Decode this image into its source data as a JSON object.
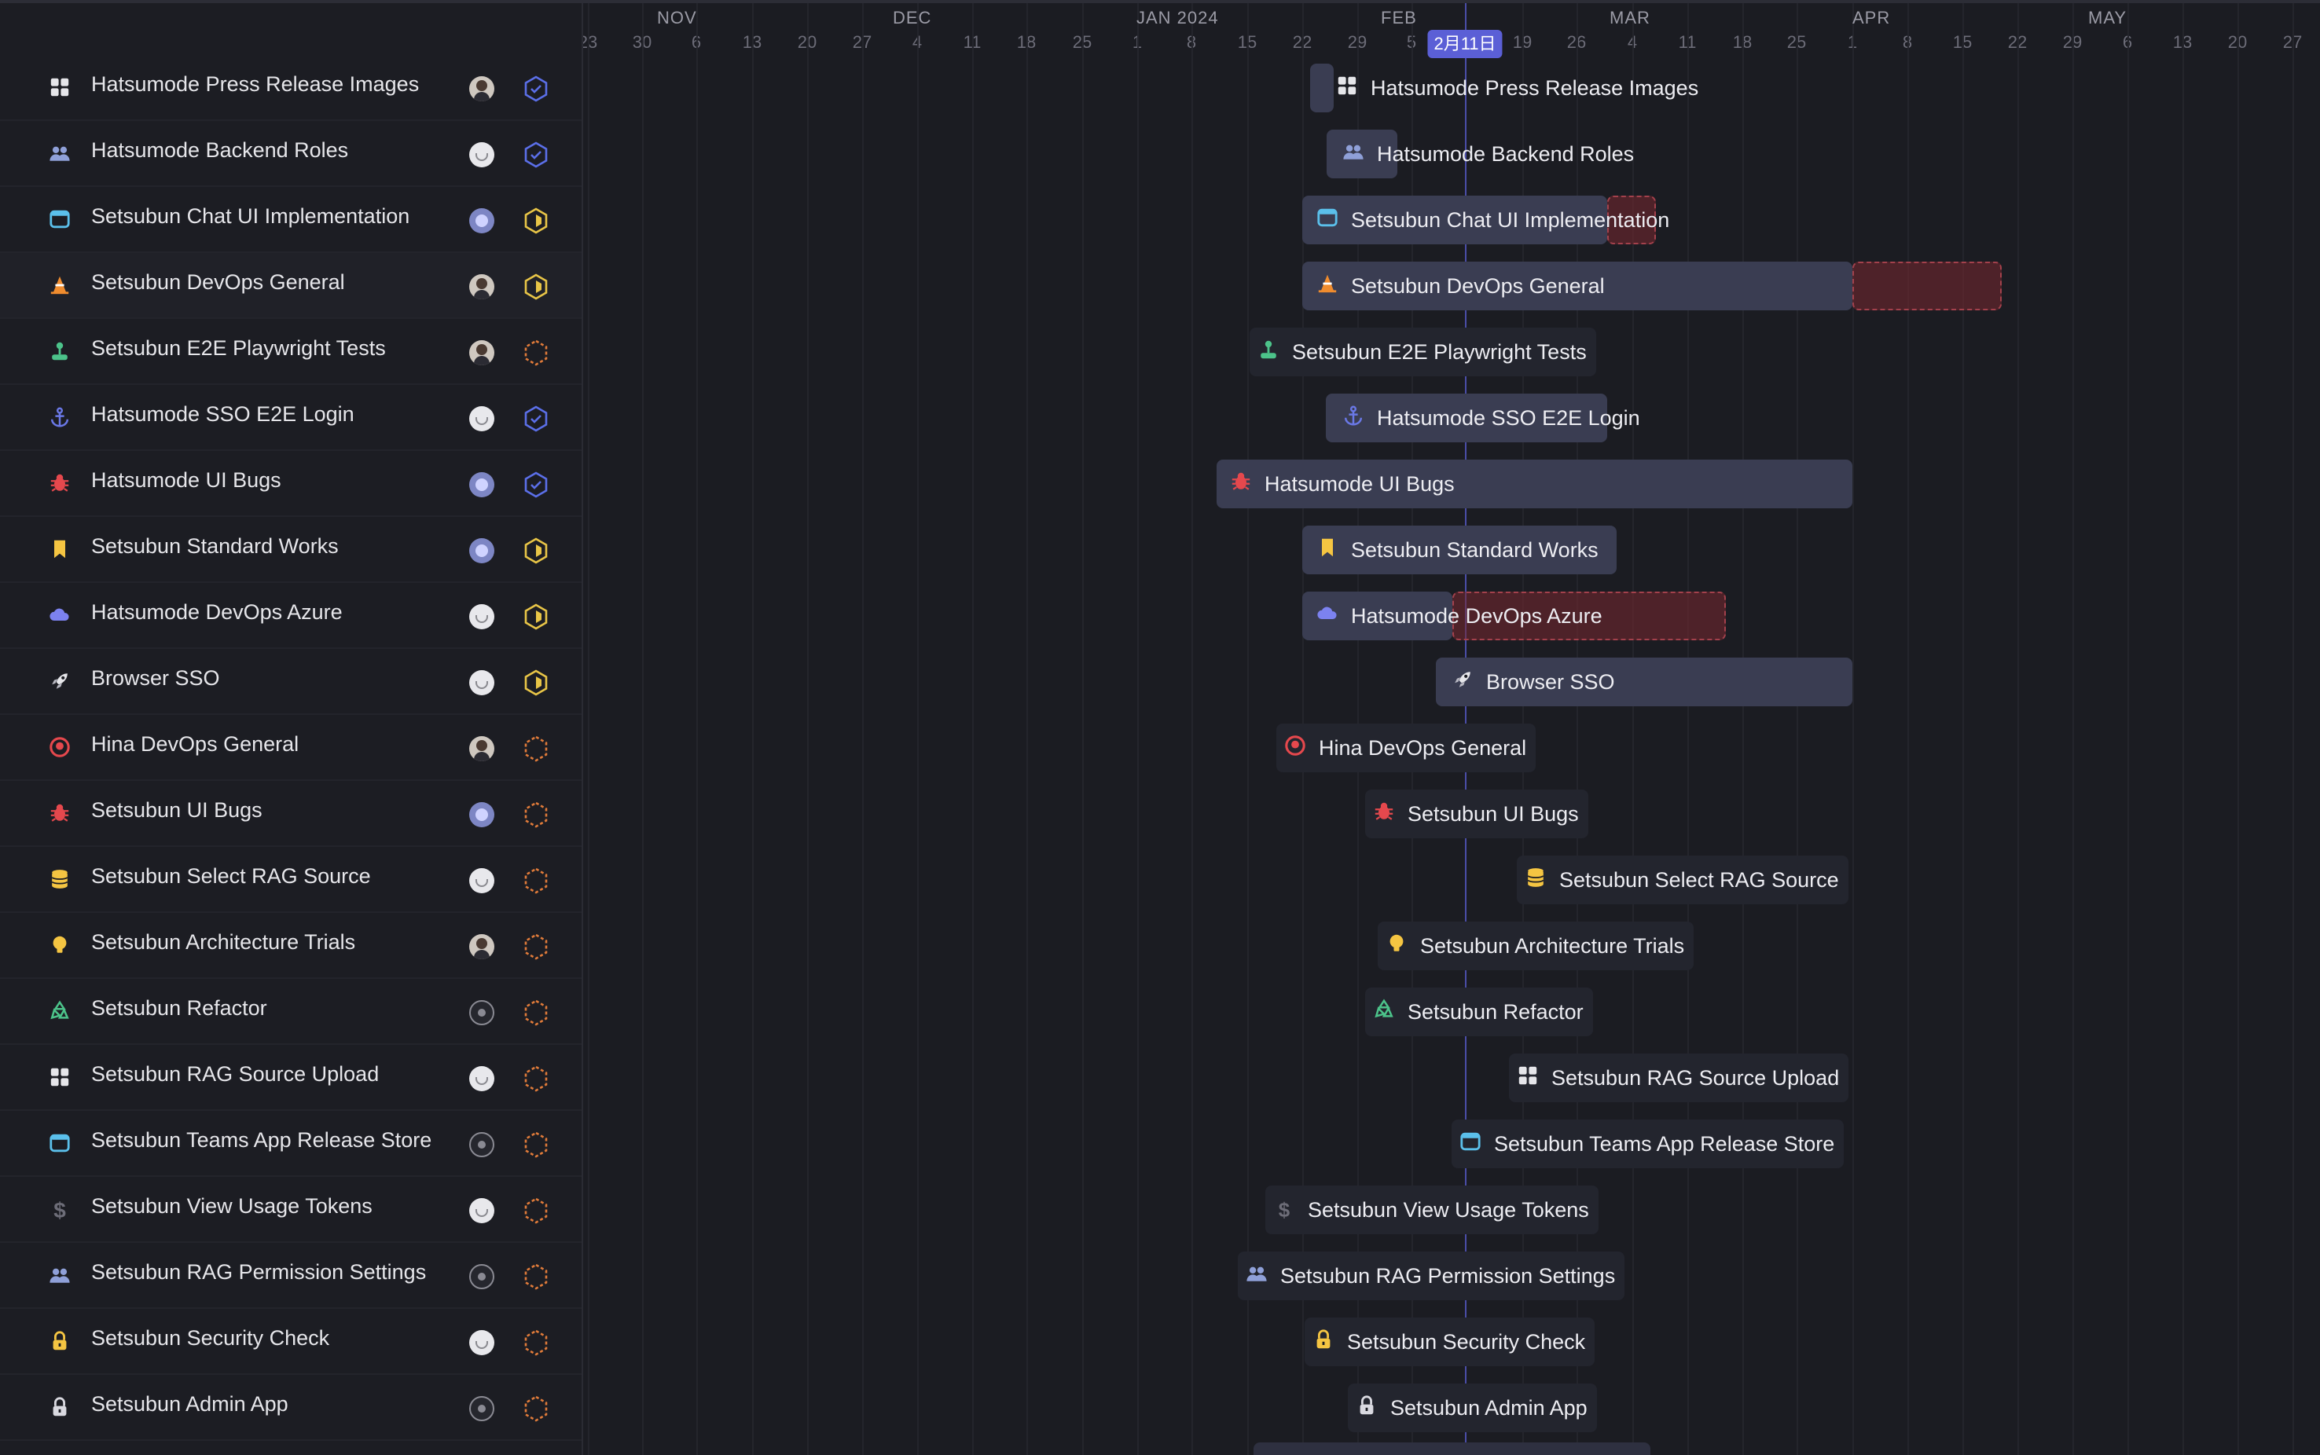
{
  "timeline": {
    "months": [
      "NOV",
      "DEC",
      "JAN 2024",
      "FEB",
      "MAR",
      "APR",
      "MAY"
    ],
    "days": [
      "23",
      "30",
      "6",
      "13",
      "20",
      "27",
      "4",
      "11",
      "18",
      "25",
      "1",
      "8",
      "15",
      "22",
      "29",
      "5",
      "19",
      "26",
      "4",
      "11",
      "18",
      "25",
      "1",
      "8",
      "15",
      "22",
      "29",
      "6",
      "13",
      "20",
      "27"
    ],
    "today_label": "2月11日"
  },
  "colors": {
    "accent": "#5b5fd6",
    "overdue": "#a3414c",
    "status_done": "#5b6fe8",
    "status_active": "#e8c547",
    "status_todo": "#e07b3a"
  },
  "tasks": [
    {
      "name": "Hatsumode Press Release Images",
      "icon": "grid-icon",
      "avatar": "man",
      "status": "done"
    },
    {
      "name": "Hatsumode Backend Roles",
      "icon": "users-icon",
      "avatar": "ghost",
      "status": "done"
    },
    {
      "name": "Setsubun Chat UI Implementation",
      "icon": "window-icon",
      "avatar": "globe",
      "status": "active"
    },
    {
      "name": "Setsubun DevOps General",
      "icon": "cone-icon",
      "avatar": "man",
      "status": "active"
    },
    {
      "name": "Setsubun E2E Playwright Tests",
      "icon": "joystick-icon",
      "avatar": "man",
      "status": "todo"
    },
    {
      "name": "Hatsumode SSO E2E Login",
      "icon": "anchor-icon",
      "avatar": "ghost",
      "status": "done"
    },
    {
      "name": "Hatsumode UI Bugs",
      "icon": "bug-icon",
      "avatar": "globe",
      "status": "done"
    },
    {
      "name": "Setsubun Standard Works",
      "icon": "bookmark-icon",
      "avatar": "globe",
      "status": "active"
    },
    {
      "name": "Hatsumode DevOps Azure",
      "icon": "cloud-icon",
      "avatar": "ghost",
      "status": "active"
    },
    {
      "name": "Browser SSO",
      "icon": "rocket-icon",
      "avatar": "ghost",
      "status": "active"
    },
    {
      "name": "Hina DevOps General",
      "icon": "github-icon",
      "avatar": "man",
      "status": "todo"
    },
    {
      "name": "Setsubun UI Bugs",
      "icon": "bug-icon",
      "avatar": "globe",
      "status": "todo"
    },
    {
      "name": "Setsubun Select RAG Source",
      "icon": "database-icon",
      "avatar": "ghost",
      "status": "todo"
    },
    {
      "name": "Setsubun Architecture Trials",
      "icon": "bulb-icon",
      "avatar": "man",
      "status": "todo"
    },
    {
      "name": "Setsubun Refactor",
      "icon": "recycle-icon",
      "avatar": "gear",
      "status": "todo"
    },
    {
      "name": "Setsubun RAG Source Upload",
      "icon": "grid-icon",
      "avatar": "ghost",
      "status": "todo"
    },
    {
      "name": "Setsubun Teams App Release Store",
      "icon": "window-icon",
      "avatar": "gear",
      "status": "todo"
    },
    {
      "name": "Setsubun View Usage Tokens",
      "icon": "dollar-icon",
      "avatar": "ghost",
      "status": "todo"
    },
    {
      "name": "Setsubun RAG Permission Settings",
      "icon": "users-icon",
      "avatar": "gear",
      "status": "todo"
    },
    {
      "name": "Setsubun Security Check",
      "icon": "lock-key-icon",
      "avatar": "ghost",
      "status": "todo"
    },
    {
      "name": "Setsubun Admin App",
      "icon": "lock-icon",
      "avatar": "gear",
      "status": "todo"
    }
  ]
}
